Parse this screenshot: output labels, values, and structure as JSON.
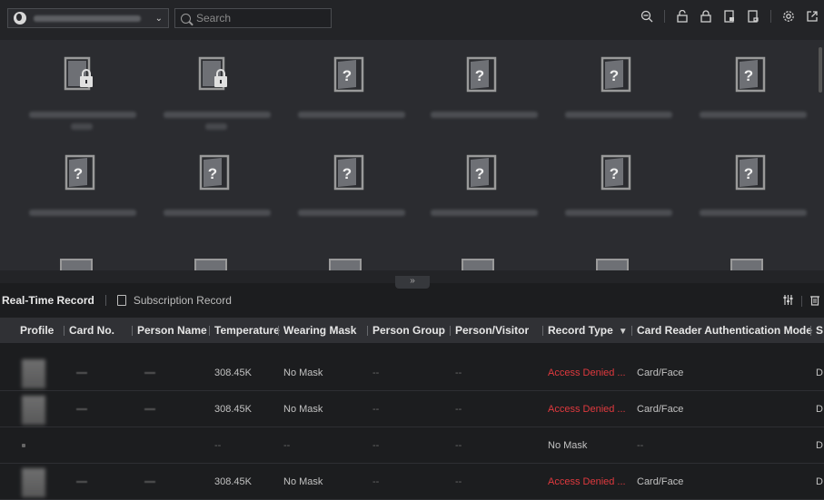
{
  "topbar": {
    "site_name": "",
    "search_placeholder": "Search",
    "tool_icons": [
      "zoom-out-icon",
      "unlock-icon",
      "lock-icon",
      "remain-open-icon",
      "remain-closed-icon",
      "settings-icon",
      "popout-icon"
    ]
  },
  "doors": {
    "rows": [
      [
        {
          "status": "locked"
        },
        {
          "status": "locked"
        },
        {
          "status": "unknown"
        },
        {
          "status": "unknown"
        },
        {
          "status": "unknown"
        },
        {
          "status": "unknown"
        }
      ],
      [
        {
          "status": "unknown"
        },
        {
          "status": "unknown"
        },
        {
          "status": "unknown"
        },
        {
          "status": "unknown"
        },
        {
          "status": "unknown"
        },
        {
          "status": "unknown"
        }
      ]
    ],
    "unknown_glyph": "?"
  },
  "collapse_glyph": "»",
  "tabs": {
    "realtime": "Real-Time Record",
    "subscription": "Subscription Record"
  },
  "table": {
    "headers": {
      "profile": "Profile",
      "card_no": "Card No.",
      "person_name": "Person Name",
      "temperature": "Temperature",
      "wearing_mask": "Wearing Mask",
      "person_group": "Person Group",
      "person_visitor": "Person/Visitor",
      "record_type": "Record Type",
      "auth_mode": "Card Reader Authentication Mode",
      "last": "S"
    },
    "rows": [
      {
        "temperature": "308.45K",
        "wearing_mask": "No Mask",
        "person_group": "--",
        "person_visitor": "--",
        "record_type": "Access Denied ...",
        "auth_mode": "Card/Face",
        "last": "D"
      },
      {
        "temperature": "308.45K",
        "wearing_mask": "No Mask",
        "person_group": "--",
        "person_visitor": "--",
        "record_type": "Access Denied ...",
        "auth_mode": "Card/Face",
        "last": "D"
      },
      {
        "temperature": "--",
        "wearing_mask": "--",
        "person_group": "--",
        "person_visitor": "--",
        "record_type": "No Mask",
        "auth_mode": "--",
        "last": "D"
      },
      {
        "temperature": "308.45K",
        "wearing_mask": "No Mask",
        "person_group": "--",
        "person_visitor": "--",
        "record_type": "Access Denied ...",
        "auth_mode": "Card/Face",
        "last": "D"
      }
    ]
  },
  "colors": {
    "accent_red": "#e0393e",
    "panel": "#2b2c30",
    "header": "#303135"
  }
}
